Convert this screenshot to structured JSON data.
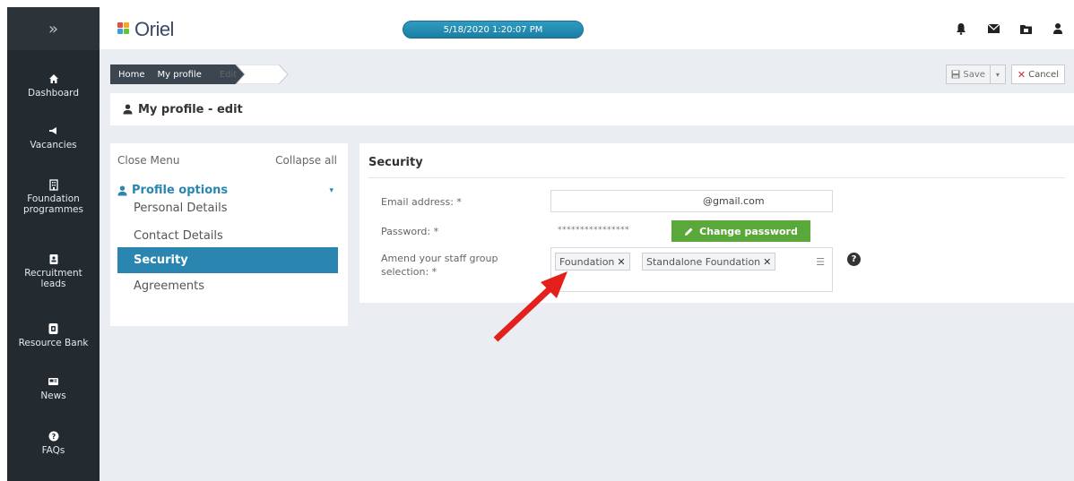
{
  "sidebar": {
    "toggle_icon": "double-chevron-right",
    "items": [
      {
        "label": "Dashboard",
        "icon": "home-icon"
      },
      {
        "label": "Vacancies",
        "icon": "megaphone-icon"
      },
      {
        "label": "Foundation programmes",
        "icon": "building-icon"
      },
      {
        "label": "Recruitment leads",
        "icon": "id-card-icon"
      },
      {
        "label": "Resource Bank",
        "icon": "document-icon"
      },
      {
        "label": "News",
        "icon": "newspaper-icon"
      },
      {
        "label": "FAQs",
        "icon": "question-icon"
      }
    ]
  },
  "header": {
    "logo_text": "Oriel",
    "datetime": "5/18/2020 1:20:07 PM",
    "icons": [
      "bell-icon",
      "envelope-icon",
      "folder-icon",
      "user-icon"
    ]
  },
  "breadcrumb": {
    "items": [
      "Home",
      "My profile",
      "Edit"
    ]
  },
  "actions": {
    "save_label": "Save",
    "cancel_label": "Cancel"
  },
  "page": {
    "title": "My profile - edit"
  },
  "menu": {
    "close_label": "Close Menu",
    "collapse_label": "Collapse all",
    "group_label": "Profile options",
    "items": [
      {
        "label": "Personal Details",
        "active": false
      },
      {
        "label": "Contact Details",
        "active": false
      },
      {
        "label": "Security",
        "active": true
      },
      {
        "label": "Agreements",
        "active": false
      }
    ]
  },
  "security": {
    "title": "Security",
    "email_label": "Email address: *",
    "email_value": "@gmail.com",
    "password_label": "Password: *",
    "password_mask": "****************",
    "change_password_label": "Change password",
    "staff_group_label_line1": "Amend your staff group",
    "staff_group_label_line2": "selection: *",
    "tags": [
      "Foundation",
      "Standalone Foundation"
    ]
  },
  "colors": {
    "sidebar_bg": "#232a30",
    "accent_blue": "#2a86b0",
    "green_button": "#5aa83a",
    "arrow_red": "#e3201b"
  }
}
